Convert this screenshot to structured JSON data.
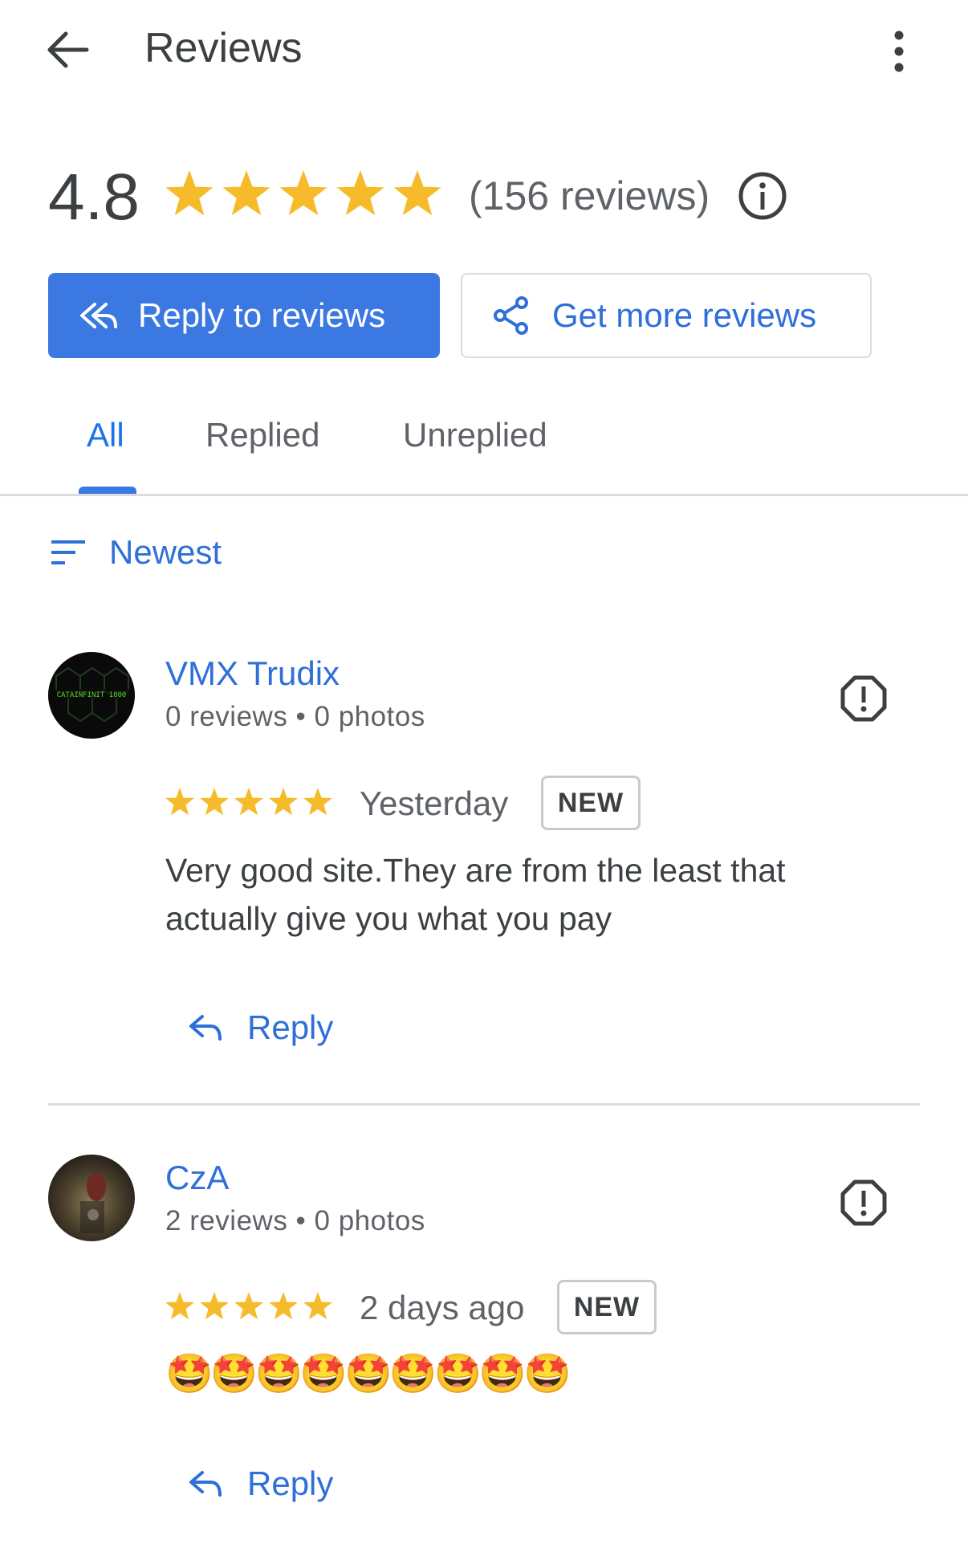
{
  "header": {
    "title": "Reviews",
    "back_icon": "arrow-back-icon",
    "more_icon": "more-vert-icon"
  },
  "summary": {
    "rating": "4.8",
    "stars": 5,
    "count_label": "(156 reviews)",
    "info_icon": "info-icon"
  },
  "actions": {
    "reply_label": "Reply to reviews",
    "get_more_label": "Get more reviews"
  },
  "tabs": [
    {
      "label": "All",
      "selected": true
    },
    {
      "label": "Replied",
      "selected": false
    },
    {
      "label": "Unreplied",
      "selected": false
    }
  ],
  "sort": {
    "label": "Newest"
  },
  "reviews": [
    {
      "name": "VMX Trudix",
      "meta": "0 reviews • 0 photos",
      "rating": 5,
      "date": "Yesterday",
      "badge": "NEW",
      "text": "Very good site.They are from the least that actually give you what you pay",
      "reply_label": "Reply",
      "avatar_text": "CATAINFINIT 1000"
    },
    {
      "name": "CzA",
      "meta": "2 reviews • 0 photos",
      "rating": 5,
      "date": "2 days ago",
      "badge": "NEW",
      "text": "🤩🤩🤩🤩🤩🤩🤩🤩🤩",
      "reply_label": "Reply"
    }
  ],
  "colors": {
    "accent": "#1a73e8",
    "button_fill": "#3c78e2",
    "star": "#f6bb2a",
    "text": "#3c4043",
    "muted": "#5f6368",
    "divider": "#dadce0"
  }
}
